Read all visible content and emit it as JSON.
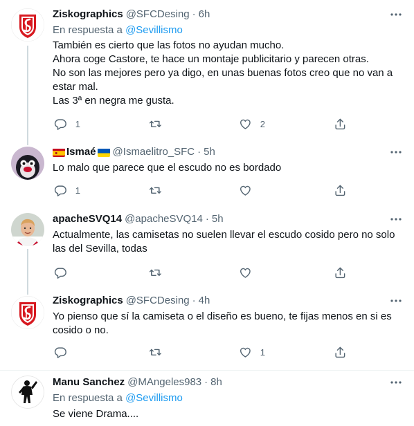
{
  "tweets": [
    {
      "name": "Ziskographics",
      "handle": "@SFCDesing",
      "dot": "·",
      "time": "6h",
      "reply_prefix": "En respuesta a",
      "reply_mention": "@Sevillismo",
      "text": "También es cierto que las fotos no ayudan mucho.\nAhora coge Castore, te hace un montaje publicitario y parecen otras.\nNo son las mejores pero ya digo, en unas buenas fotos creo que no van a estar mal.\nLas 3ª en negra me gusta.",
      "replies": "1",
      "retweets": "",
      "likes": "2",
      "avatar": "sevilla-crest"
    },
    {
      "name": "Ismaé",
      "handle": "@Ismaelitro_SFC",
      "dot": "·",
      "time": "5h",
      "text": "Lo malo que parece que el escudo no es bordado",
      "replies": "1",
      "retweets": "",
      "likes": "",
      "avatar": "penguin",
      "flags": [
        "spain-flag-icon",
        "ukraine-flag-icon"
      ]
    },
    {
      "name": "apacheSVQ14",
      "handle": "@apacheSVQ14",
      "dot": "·",
      "time": "5h",
      "text": "Actualmente, las camisetas no suelen llevar el escudo cosido pero no solo las del Sevilla, todas",
      "replies": "",
      "retweets": "",
      "likes": "",
      "avatar": "child-photo"
    },
    {
      "name": "Ziskographics",
      "handle": "@SFCDesing",
      "dot": "·",
      "time": "4h",
      "text": "Yo pienso que sí la camiseta o el diseño es bueno, te fijas menos en si es cosido o no.",
      "replies": "",
      "retweets": "",
      "likes": "1",
      "avatar": "sevilla-crest"
    },
    {
      "name": "Manu Sanchez",
      "handle": "@MAngeles983",
      "dot": "·",
      "time": "8h",
      "reply_prefix": "En respuesta a",
      "reply_mention": "@Sevillismo",
      "text": "Se viene Drama....",
      "avatar": "silhouette"
    }
  ],
  "colors": {
    "text": "#0f1419",
    "secondary": "#536471",
    "accent": "#1d9bf0",
    "thread_line": "#cfd9de",
    "crest_red": "#d71920"
  }
}
